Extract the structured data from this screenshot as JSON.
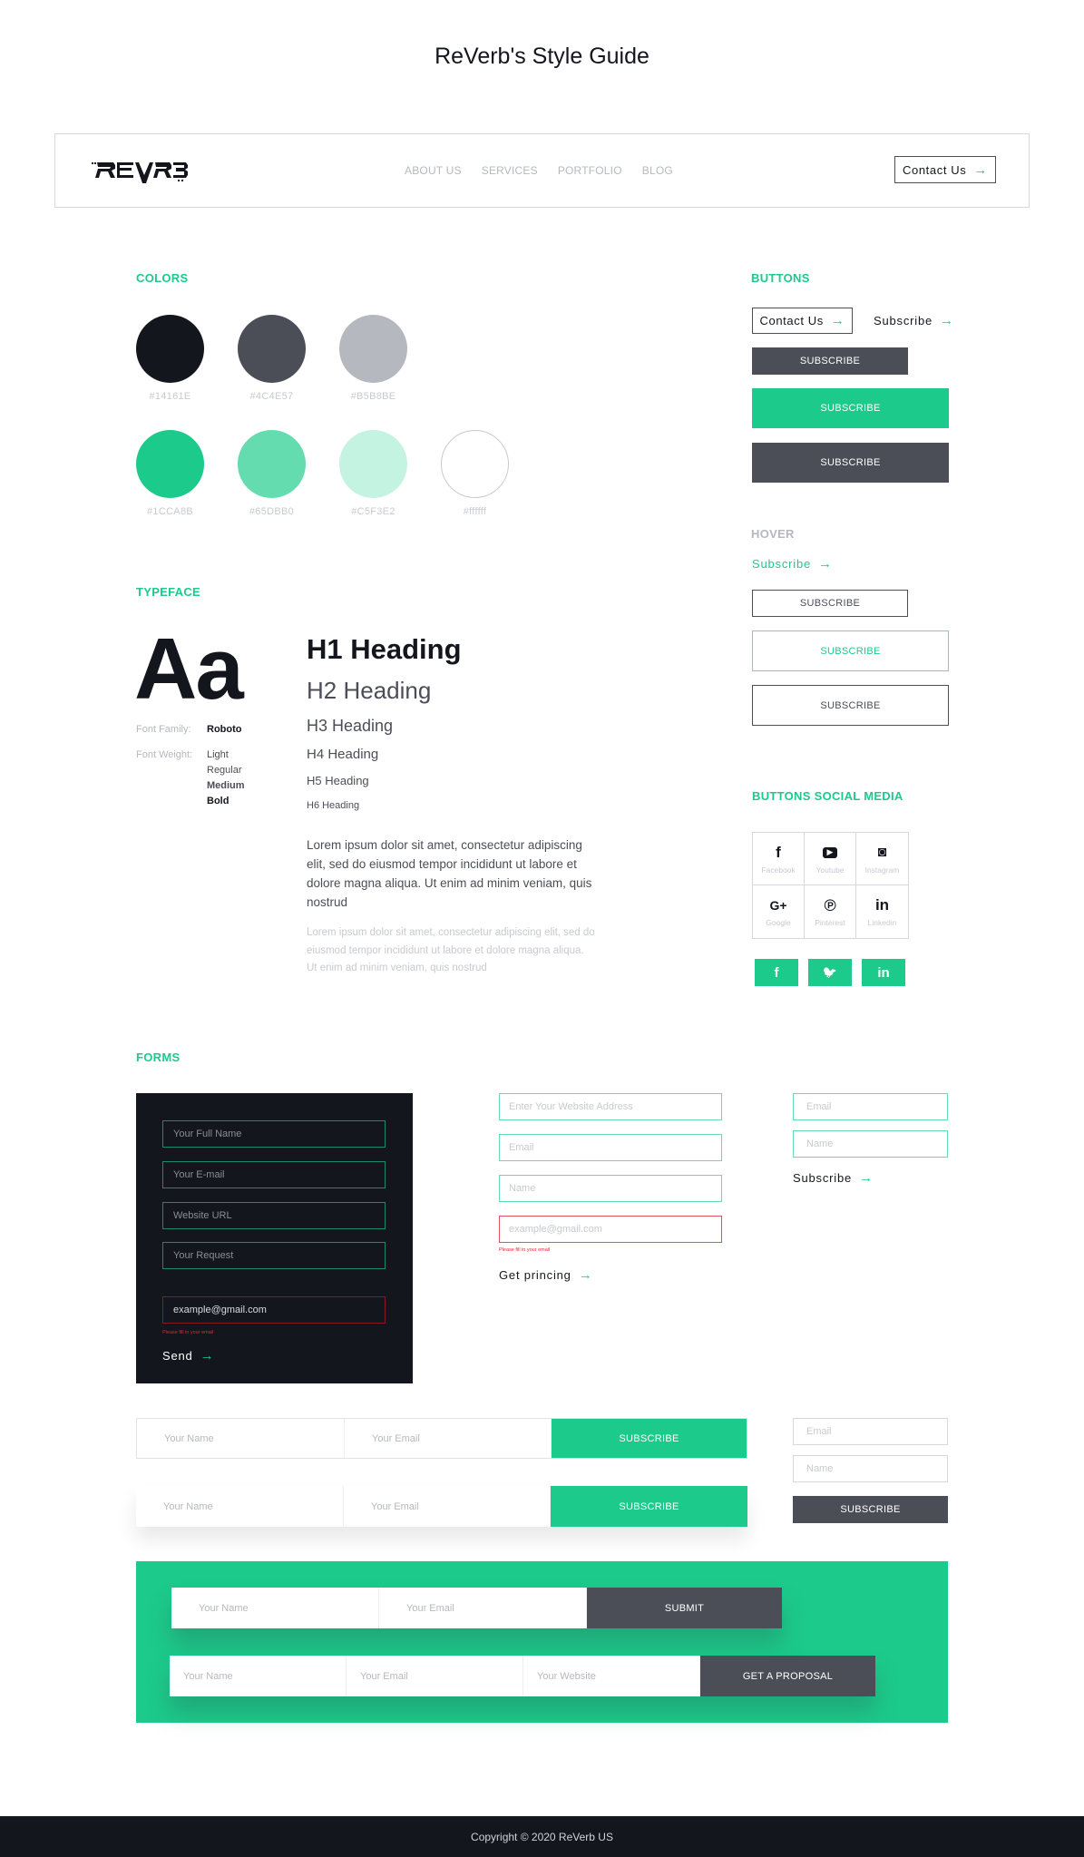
{
  "page_title": "ReVerb's Style Guide",
  "header": {
    "logo_alt": "ReVerb logo",
    "nav": [
      "ABOUT US",
      "SERVICES",
      "PORTFOLIO",
      "BLOG"
    ],
    "contact_label": "Contact Us",
    "arrow": "→"
  },
  "colors": {
    "title": "COLORS",
    "swatches": [
      {
        "hex": "#14161E",
        "label": "#14161E"
      },
      {
        "hex": "#4C4E57",
        "label": "#4C4E57"
      },
      {
        "hex": "#B5B8BE",
        "label": "#B5B8BE"
      },
      {
        "hex": "#1CCA8B",
        "label": "#1CCA8B"
      },
      {
        "hex": "#65DBB0",
        "label": "#65DBB0"
      },
      {
        "hex": "#C5F3E2",
        "label": "#C5F3E2"
      },
      {
        "hex": "#ffffff",
        "label": "#ffffff"
      }
    ]
  },
  "typeface": {
    "title": "TYPEFACE",
    "sample": "Aa",
    "family_label": "Font Family:",
    "family_value": "Roboto",
    "weight_label": "Font Weight:",
    "weights": [
      "Light",
      "Regular",
      "Medium",
      "Bold"
    ],
    "headings": [
      "H1 Heading",
      "H2 Heading",
      "H3 Heading",
      "H4 Heading",
      "H5 Heading",
      "H6 Heading"
    ],
    "paragraph": "Lorem ipsum dolor sit amet, consectetur adipiscing elit, sed do eiusmod tempor incididunt ut labore et dolore magna aliqua. Ut enim ad minim veniam, quis nostrud",
    "paragraph_light": "Lorem ipsum dolor sit amet, consectetur adipiscing elit, sed do eiusmod tempor incididunt ut labore et dolore magna aliqua. Ut enim ad minim veniam, quis nostrud"
  },
  "buttons": {
    "title": "BUTTONS",
    "contact_label": "Contact Us",
    "subscribe_link": "Subscribe",
    "subscribe": "SUBSCRIBE",
    "arrow": "→"
  },
  "hover": {
    "title": "HOVER",
    "subscribe_link": "Subscribe",
    "subscribe": "SUBSCRIBE"
  },
  "social": {
    "title": "BUTTONS SOCIAL MEDIA",
    "grid": [
      {
        "icon": "facebook-icon",
        "glyph": "f",
        "label": "Facebook"
      },
      {
        "icon": "youtube-icon",
        "glyph": "▶",
        "label": "Youtube"
      },
      {
        "icon": "instagram-icon",
        "glyph": "◙",
        "label": "Instagram"
      },
      {
        "icon": "google-plus-icon",
        "glyph": "G+",
        "label": "Google"
      },
      {
        "icon": "pinterest-icon",
        "glyph": "℗",
        "label": "Pinterest"
      },
      {
        "icon": "linkedin-icon",
        "glyph": "in",
        "label": "Linkedin"
      }
    ],
    "buttons": [
      {
        "icon": "facebook-icon",
        "glyph": "f"
      },
      {
        "icon": "twitter-icon",
        "glyph": "🐦"
      },
      {
        "icon": "linkedin-icon",
        "glyph": "in"
      }
    ]
  },
  "forms": {
    "title": "FORMS",
    "dark": {
      "fields": [
        "Your Full Name",
        "Your E-mail",
        "Website URL",
        "Your Request"
      ],
      "error_value": "example@gmail.com",
      "error_msg": "Please fill in your email",
      "send_label": "Send"
    },
    "middle": {
      "fields": [
        "Enter Your Website Address",
        "Email",
        "Name"
      ],
      "error_placeholder": "example@gmail.com",
      "error_msg": "Please fill in your email",
      "cta_label": "Get princing"
    },
    "right_top": {
      "fields": [
        "Email",
        "Name"
      ],
      "cta_label": "Subscribe"
    },
    "inline1": {
      "name": "Your Name",
      "email": "Your Email",
      "button": "SUBSCRIBE"
    },
    "inline2": {
      "name": "Your Name",
      "email": "Your Email",
      "button": "SUBSCRIBE"
    },
    "right_bottom": {
      "fields": [
        "Email",
        "Name"
      ],
      "button": "SUBSCRIBE"
    },
    "green1": {
      "name": "Your Name",
      "email": "Your Email",
      "button": "SUBMIT"
    },
    "green2": {
      "name": "Your Name",
      "email": "Your Email",
      "website": "Your Website",
      "button": "GET A PROPOSAL"
    }
  },
  "footer": {
    "copyright": "Copyright © 2020 ReVerb US"
  },
  "palette": {
    "accent": "#1CCA8B",
    "dark": "#14161E",
    "slate": "#4C4E57",
    "error": "#e0253a"
  }
}
